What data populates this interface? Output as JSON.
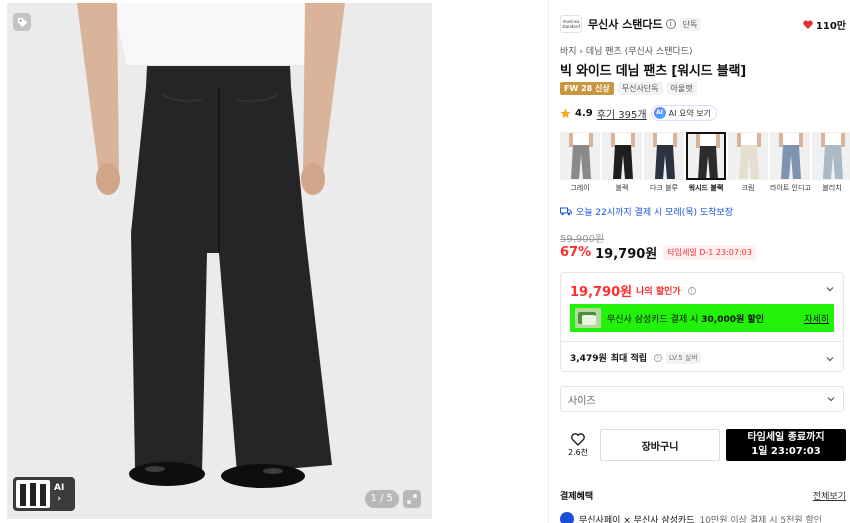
{
  "image": {
    "counter": "1 / 5",
    "ai_label": "AI"
  },
  "brand": {
    "logo_line1": "musinsa",
    "logo_line2": "standard",
    "name": "무신사 스탠다드",
    "info": "i",
    "exclusive": "단독"
  },
  "likes": {
    "count": "110만",
    "color": "#e62e2e"
  },
  "breadcrumb": "바지 › 데님 팬츠 (무신사 스탠다드)",
  "title": "빅 와이드 데님 팬츠 [워시드 블랙]",
  "badges": [
    "FW 28 신상",
    "무신사단독",
    "아울렛"
  ],
  "rating": {
    "score": "4.9",
    "reviews": "후기 395개",
    "ai_icon": "AI",
    "ai_summary": "AI 요약 보기"
  },
  "colors": [
    {
      "name": "그레이",
      "shade": "#8a8a8a"
    },
    {
      "name": "블랙",
      "shade": "#1e1e1e"
    },
    {
      "name": "다크 블루",
      "shade": "#2c3340"
    },
    {
      "name": "워시드 블랙",
      "shade": "#2b2b2b"
    },
    {
      "name": "크림",
      "shade": "#e6dfcf"
    },
    {
      "name": "라이트 인디고",
      "shade": "#7d93b0"
    },
    {
      "name": "블리치",
      "shade": "#a9b9c6"
    }
  ],
  "delivery": "오늘 22시까지 결제 시 모레(목) 도착보장",
  "price": {
    "original": "59,900원",
    "discount": "67%",
    "sale": "19,790원",
    "timesale": "타임세일 D-1 23:07:03",
    "accent": "#ff2d2d"
  },
  "benefit": {
    "my_price": "19,790원",
    "my_price_label": "나의 할인가",
    "card_text_pre": "무신사 삼성카드 결제 시",
    "card_amount": "30,000원 할인",
    "card_more": "자세히",
    "card_color": "#22f20a",
    "points_amount": "3,479원",
    "points_label": "최대 적립",
    "level": "LV.5 실버"
  },
  "size_select": {
    "placeholder": "사이즈"
  },
  "actions": {
    "like_count": "2.6천",
    "cart": "장바구니",
    "buy_line1": "타임세일 종료까지",
    "buy_line2": "1일 23:07:03"
  },
  "payment": {
    "heading": "결제혜택",
    "view_all": "전체보기",
    "row_main": "무신사페이 × 무신사 삼성카드",
    "row_sub": "10만원 이상 결제 시 5천원 할인"
  }
}
